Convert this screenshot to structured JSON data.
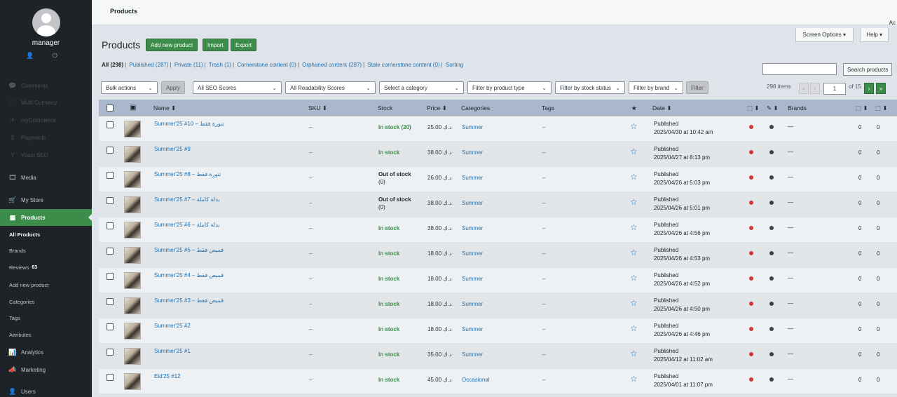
{
  "sidebar": {
    "user": "manager",
    "user_icons": "👤 ⏻",
    "items": [
      {
        "label": "Comments",
        "icon": "💬"
      },
      {
        "label": "Multi Currency",
        "icon": "⬚"
      },
      {
        "label": "myCommerce",
        "icon": "✈"
      },
      {
        "label": "Payments",
        "icon": "$"
      },
      {
        "label": "Yoast SEO",
        "icon": "Y"
      },
      {
        "label": "Media",
        "icon": "🎞"
      },
      {
        "label": "My Store",
        "icon": "🛒"
      },
      {
        "label": "Products",
        "icon": "▦"
      }
    ],
    "submenu": [
      "All Products",
      "Brands",
      "Reviews",
      "Add new product",
      "Categories",
      "Tags",
      "Attributes"
    ],
    "reviews_count": "63",
    "bottom_items": [
      {
        "label": "Analytics",
        "icon": "📊"
      },
      {
        "label": "Marketing",
        "icon": "📣"
      },
      {
        "label": "Users",
        "icon": "👤"
      }
    ]
  },
  "topbar": {
    "crumb": "Products",
    "ac": "Ac"
  },
  "header": {
    "screen_options": "Screen Options ▾",
    "help": "Help ▾",
    "title": "Products",
    "add_new": "Add new product",
    "import": "Import",
    "export": "Export"
  },
  "views": [
    {
      "label": "All",
      "count": "(298)",
      "current": true
    },
    {
      "label": "Published",
      "count": "(287)"
    },
    {
      "label": "Private",
      "count": "(11)"
    },
    {
      "label": "Trash",
      "count": "(1)"
    },
    {
      "label": "Cornerstone content",
      "count": "(0)"
    },
    {
      "label": "Orphaned content",
      "count": "(287)"
    },
    {
      "label": "Stale cornerstone content",
      "count": "(0)"
    },
    {
      "label": "Sorting",
      "count": ""
    }
  ],
  "search": {
    "placeholder": "",
    "button": "Search products"
  },
  "filters": {
    "bulk_actions": "Bulk actions",
    "apply": "Apply",
    "seo": "All SEO Scores",
    "readability": "All Readability Scores",
    "category": "Select a category",
    "product_type": "Filter by product type",
    "stock_status": "Filter by stock status",
    "brand": "Filter by brand",
    "filter": "Filter"
  },
  "pagination": {
    "items": "298 items",
    "first": "«",
    "prev": "‹",
    "current": "1",
    "of": "of 15",
    "next": "›",
    "last": "»"
  },
  "columns": {
    "name": "Name ⬍",
    "sku": "SKU ⬍",
    "stock": "Stock",
    "price": "Price ⬍",
    "categories": "Categories",
    "tags": "Tags",
    "featured": "★",
    "date": "Date ⬍",
    "seo_col": "⬚ ⬍",
    "read_col": "✎ ⬍",
    "brands": "Brands",
    "links_in": "⬚ ⬍",
    "links_out": "⬚ ⬍"
  },
  "rows": [
    {
      "name": "Summer'25 #10 – تنورة فقط",
      "sku": "–",
      "stock": "In stock (20)",
      "in_stock": true,
      "stock_count": "",
      "price": "25.00 د.ك",
      "category": "Summer",
      "tags": "–",
      "status": "Published",
      "date": "2025/04/30 at 10:42 am",
      "brand": "—",
      "links_in": "0",
      "links_out": "0"
    },
    {
      "name": "Summer'25 #9",
      "sku": "–",
      "stock": "In stock",
      "in_stock": true,
      "stock_count": "",
      "price": "38.00 د.ك",
      "category": "Summer",
      "tags": "–",
      "status": "Published",
      "date": "2025/04/27 at 8:13 pm",
      "brand": "—",
      "links_in": "0",
      "links_out": "0"
    },
    {
      "name": "Summer'25 #8 – تنورة فقط",
      "sku": "–",
      "stock": "Out of stock",
      "in_stock": false,
      "stock_count": "(0)",
      "price": "26.00 د.ك",
      "category": "Summer",
      "tags": "–",
      "status": "Published",
      "date": "2025/04/26 at 5:03 pm",
      "brand": "—",
      "links_in": "0",
      "links_out": "0"
    },
    {
      "name": "Summer'25 #7 – بدلة كاملة",
      "sku": "–",
      "stock": "Out of stock",
      "in_stock": false,
      "stock_count": "(0)",
      "price": "38.00 د.ك",
      "category": "Summer",
      "tags": "–",
      "status": "Published",
      "date": "2025/04/26 at 5:01 pm",
      "brand": "—",
      "links_in": "0",
      "links_out": "0"
    },
    {
      "name": "Summer'25 #6 – بدلة كاملة",
      "sku": "–",
      "stock": "In stock",
      "in_stock": true,
      "stock_count": "",
      "price": "38.00 د.ك",
      "category": "Summer",
      "tags": "–",
      "status": "Published",
      "date": "2025/04/26 at 4:56 pm",
      "brand": "—",
      "links_in": "0",
      "links_out": "0"
    },
    {
      "name": "Summer'25 #5 – قميص فقط",
      "sku": "–",
      "stock": "In stock",
      "in_stock": true,
      "stock_count": "",
      "price": "18.00 د.ك",
      "category": "Summer",
      "tags": "–",
      "status": "Published",
      "date": "2025/04/26 at 4:53 pm",
      "brand": "—",
      "links_in": "0",
      "links_out": "0"
    },
    {
      "name": "Summer'25 #4 – قميص فقط",
      "sku": "–",
      "stock": "In stock",
      "in_stock": true,
      "stock_count": "",
      "price": "18.00 د.ك",
      "category": "Summer",
      "tags": "–",
      "status": "Published",
      "date": "2025/04/26 at 4:52 pm",
      "brand": "—",
      "links_in": "0",
      "links_out": "0"
    },
    {
      "name": "Summer'25 #3 – قميص فقط",
      "sku": "–",
      "stock": "In stock",
      "in_stock": true,
      "stock_count": "",
      "price": "18.00 د.ك",
      "category": "Summer",
      "tags": "–",
      "status": "Published",
      "date": "2025/04/26 at 4:50 pm",
      "brand": "—",
      "links_in": "0",
      "links_out": "0"
    },
    {
      "name": "Summer'25 #2",
      "sku": "–",
      "stock": "In stock",
      "in_stock": true,
      "stock_count": "",
      "price": "18.00 د.ك",
      "category": "Summer",
      "tags": "–",
      "status": "Published",
      "date": "2025/04/26 at 4:46 pm",
      "brand": "—",
      "links_in": "0",
      "links_out": "0"
    },
    {
      "name": "Summer'25 #1",
      "sku": "–",
      "stock": "In stock",
      "in_stock": true,
      "stock_count": "",
      "price": "35.00 د.ك",
      "category": "Summer",
      "tags": "–",
      "status": "Published",
      "date": "2025/04/12 at 11:02 am",
      "brand": "—",
      "links_in": "0",
      "links_out": "0"
    },
    {
      "name": "Eid'25 #12",
      "sku": "–",
      "stock": "In stock",
      "in_stock": true,
      "stock_count": "",
      "price": "45.00 د.ك",
      "category": "Occasional",
      "tags": "–",
      "status": "Published",
      "date": "2025/04/01 at 11:07 pm",
      "brand": "—",
      "links_in": "0",
      "links_out": "0"
    }
  ],
  "colors": {
    "accent": "#3c8c4a",
    "link": "#2271b1",
    "sidebar": "#1d2327",
    "seo_dot": "#d63638"
  }
}
